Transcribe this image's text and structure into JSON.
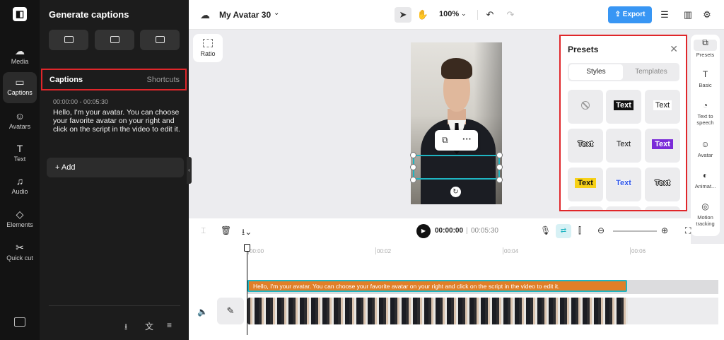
{
  "rail": {
    "items": [
      {
        "label": "Media",
        "icon": "cloud-upload-icon"
      },
      {
        "label": "Captions",
        "icon": "captions-icon"
      },
      {
        "label": "Avatars",
        "icon": "avatar-icon"
      },
      {
        "label": "Text",
        "icon": "text-icon"
      },
      {
        "label": "Audio",
        "icon": "music-icon"
      },
      {
        "label": "Elements",
        "icon": "elements-icon"
      },
      {
        "label": "Quick cut",
        "icon": "scissors-icon"
      }
    ]
  },
  "panel": {
    "title": "Generate captions",
    "tab_captions": "Captions",
    "tab_shortcuts": "Shortcuts",
    "caption_time": "00:00:00 - 00:05:30",
    "caption_text": "Hello, I'm your avatar. You can choose your favorite avatar on your right and click on the script in the video to edit it.",
    "add_label": "+ Add"
  },
  "topbar": {
    "project_title": "My Avatar 30",
    "zoom": "100%",
    "export_label": "Export"
  },
  "canvas": {
    "ratio_label": "Ratio"
  },
  "presets": {
    "title": "Presets",
    "tab_styles": "Styles",
    "tab_templates": "Templates",
    "tile_text": "Text"
  },
  "rside": {
    "presets": "Presets",
    "basic": "Basic",
    "tts": "Text to speech",
    "avatar": "Avatar",
    "animate": "Animat...",
    "motion": "Motion tracking"
  },
  "timeline": {
    "current_time": "00:00:00",
    "separator": "|",
    "duration": "00:05:30",
    "ticks": [
      "00:00",
      "00:02",
      "00:04",
      "00:06"
    ],
    "caption_clip": "Hello, I'm your avatar. You can choose your favorite avatar on your right and click on the script in the video to edit it."
  },
  "colors": {
    "accent": "#3896f4",
    "highlight_box": "#e0262a",
    "selection": "#1fb5c2",
    "caption_clip": "#e07f28"
  }
}
